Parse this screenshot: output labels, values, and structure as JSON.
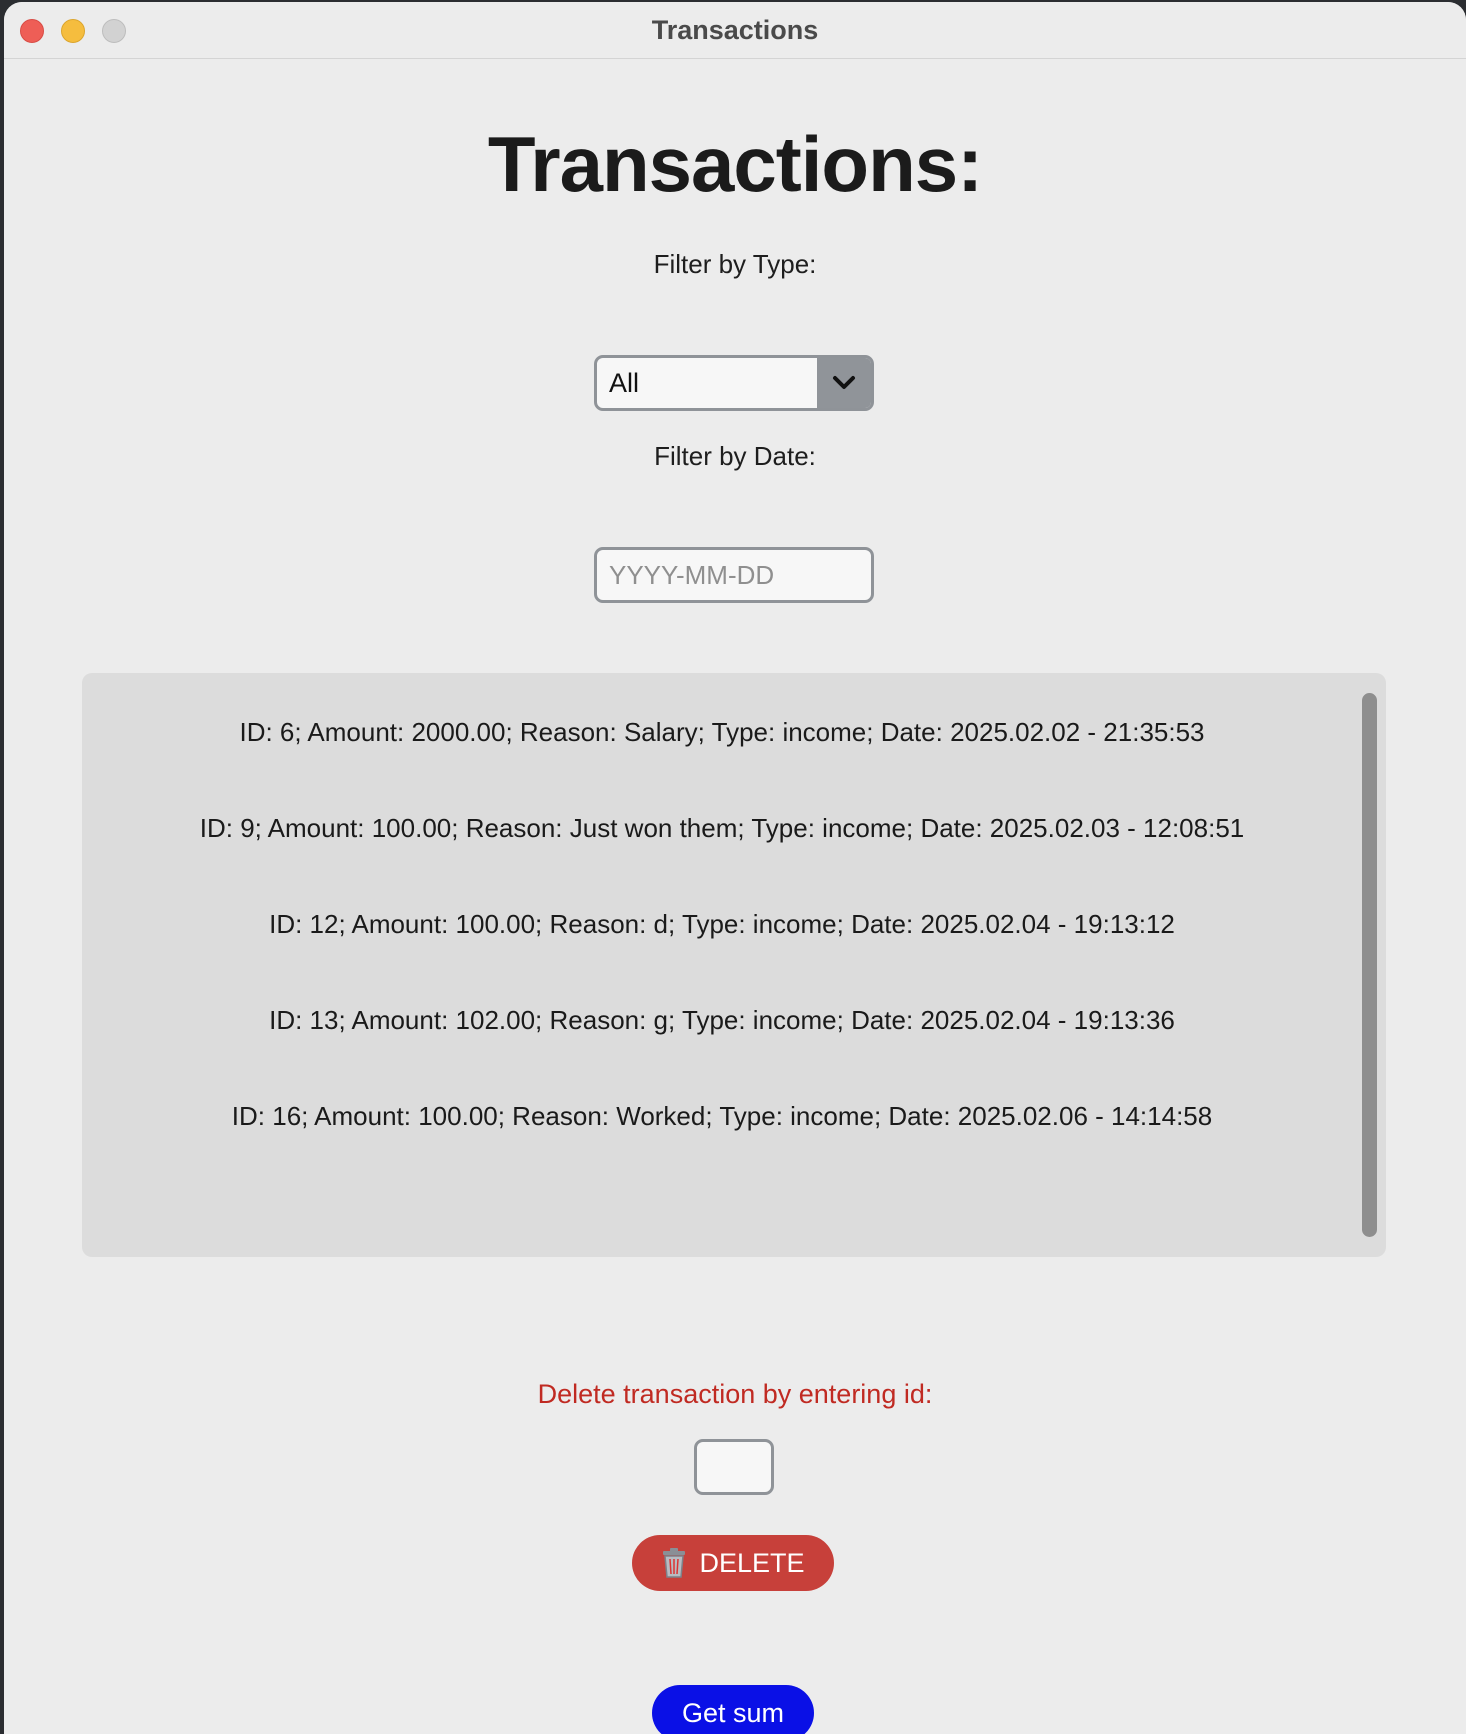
{
  "window": {
    "title": "Transactions"
  },
  "page": {
    "heading": "Transactions:"
  },
  "filters": {
    "type_label": "Filter by Type:",
    "type_selected": "All",
    "date_label": "Filter by Date:",
    "date_placeholder": "YYYY-MM-DD",
    "date_value": ""
  },
  "transactions": [
    "ID: 6; Amount: 2000.00; Reason: Salary; Type: income; Date: 2025.02.02 - 21:35:53",
    "ID: 9; Amount: 100.00; Reason: Just won them; Type: income; Date: 2025.02.03 - 12:08:51",
    "ID: 12; Amount: 100.00; Reason: d; Type: income; Date: 2025.02.04 - 19:13:12",
    "ID: 13; Amount: 102.00; Reason: g; Type: income; Date: 2025.02.04 - 19:13:36",
    "ID: 16; Amount: 100.00; Reason: Worked; Type: income; Date: 2025.02.06 - 14:14:58"
  ],
  "delete": {
    "label": "Delete transaction by entering id:",
    "id_value": "",
    "button_label": "DELETE",
    "button_icon": "trash-icon"
  },
  "sum": {
    "button_label": "Get sum"
  },
  "colors": {
    "delete_label": "#c02a22",
    "delete_button": "#c7403a",
    "sum_button": "#0a10e6",
    "list_background": "#dcdcdc"
  }
}
